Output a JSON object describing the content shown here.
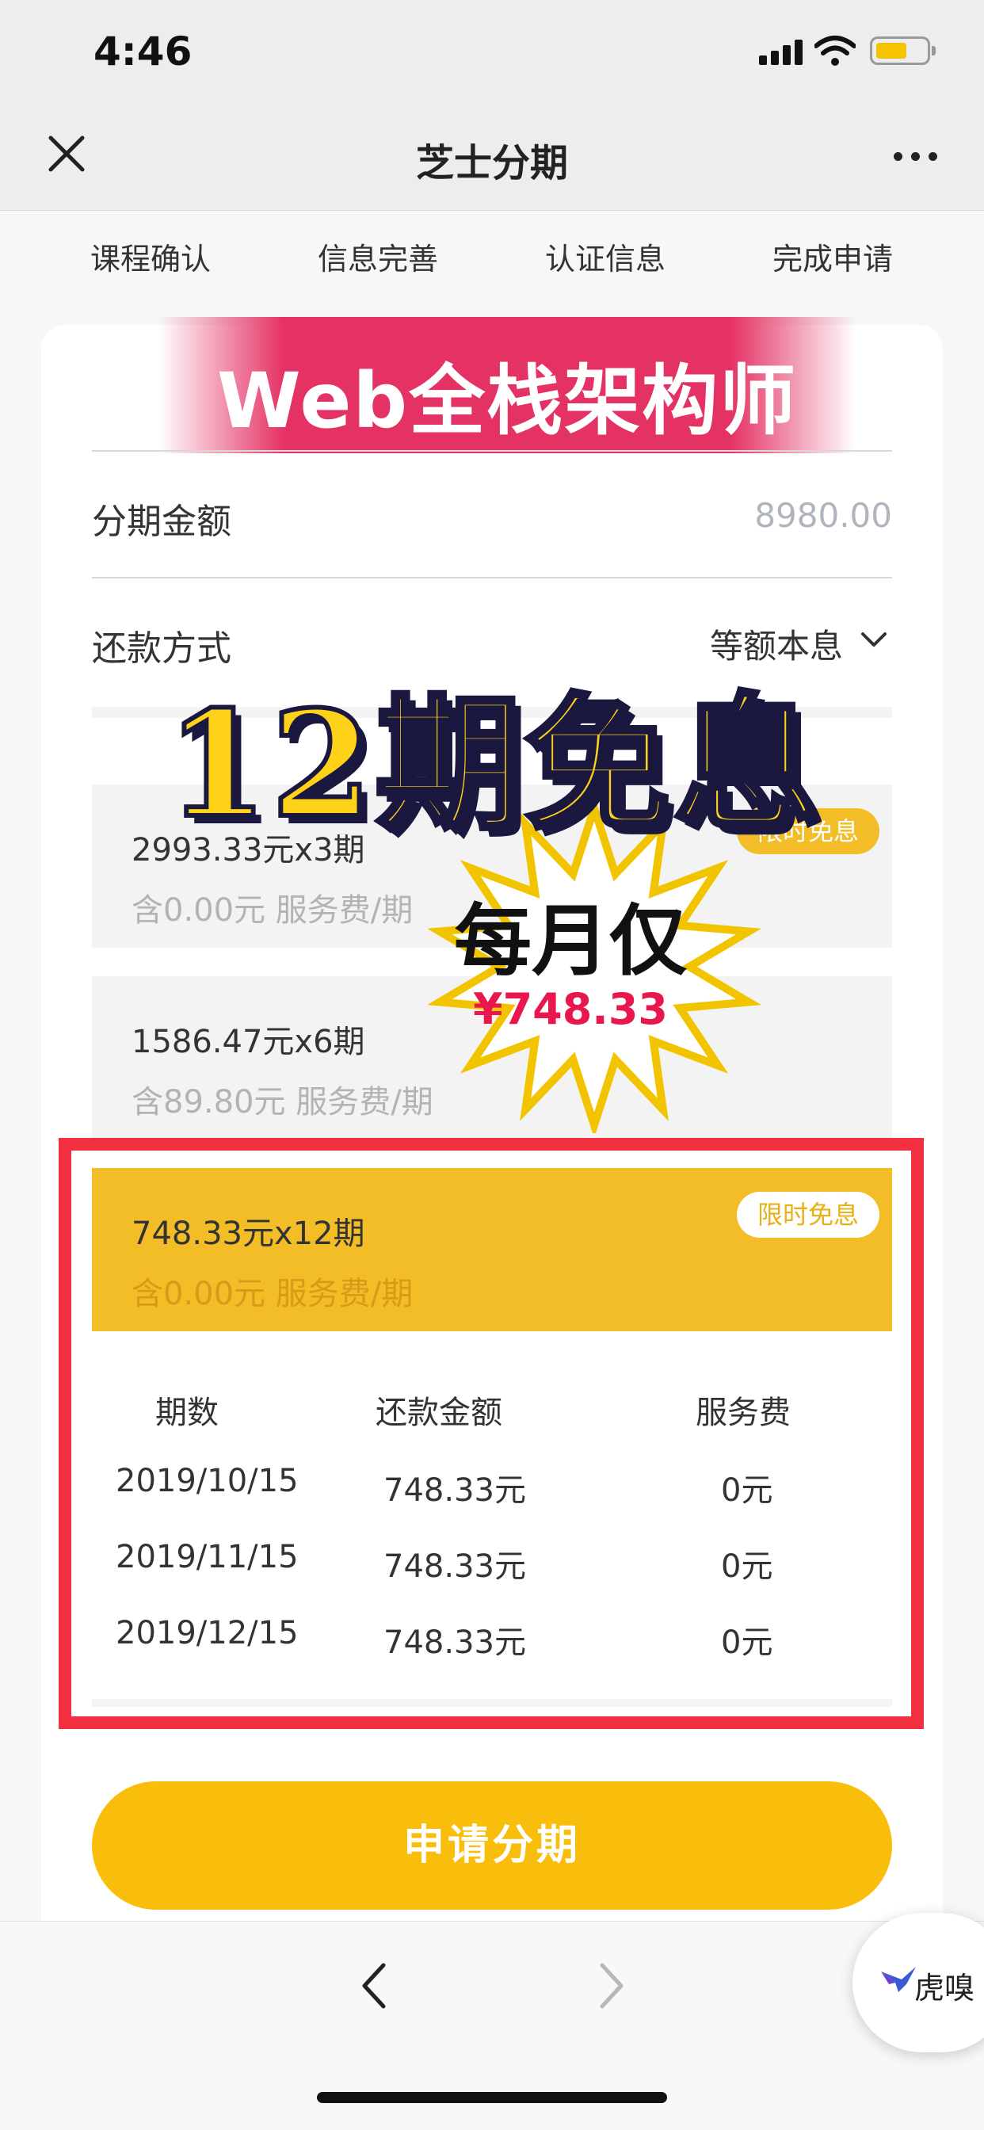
{
  "status_bar": {
    "time": "4:46",
    "battery_color": "#f5c400"
  },
  "navbar": {
    "title": "芝士分期",
    "close_icon": "close-icon",
    "more_icon": "more-icon"
  },
  "steps": [
    "课程确认",
    "信息完善",
    "认证信息",
    "完成申请"
  ],
  "course": {
    "banner_title": "Web全栈架构师"
  },
  "form": {
    "amount_label": "分期金额",
    "amount_value": "8980.00",
    "repay_label": "还款方式",
    "repay_value": "等额本息"
  },
  "plans": [
    {
      "main": "2993.33元x3期",
      "sub": "含0.00元 服务费/期",
      "badge": "限时免息",
      "selected": false
    },
    {
      "main": "1586.47元x6期",
      "sub": "含89.80元 服务费/期",
      "badge": "",
      "selected": false
    },
    {
      "main": "748.33元x12期",
      "sub": "含0.00元 服务费/期",
      "badge": "限时免息",
      "selected": true
    }
  ],
  "schedule": {
    "headers": [
      "期数",
      "还款金额",
      "服务费"
    ],
    "rows": [
      [
        "2019/10/15",
        "748.33元",
        "0元"
      ],
      [
        "2019/11/15",
        "748.33元",
        "0元"
      ],
      [
        "2019/12/15",
        "748.33元",
        "0元"
      ]
    ]
  },
  "apply_button": "申请分期",
  "bottom_nav": {
    "back_icon": "chevron-left-icon",
    "forward_icon": "chevron-right-icon",
    "float_text": "虎嗅"
  },
  "overlay": {
    "headline": "12期免息",
    "starburst_title": "每月仅",
    "starburst_price": "¥748.33"
  },
  "colors": {
    "accent_yellow": "#f9bd0c",
    "highlight_red": "#f23041",
    "banner_pink": "#e43264"
  }
}
